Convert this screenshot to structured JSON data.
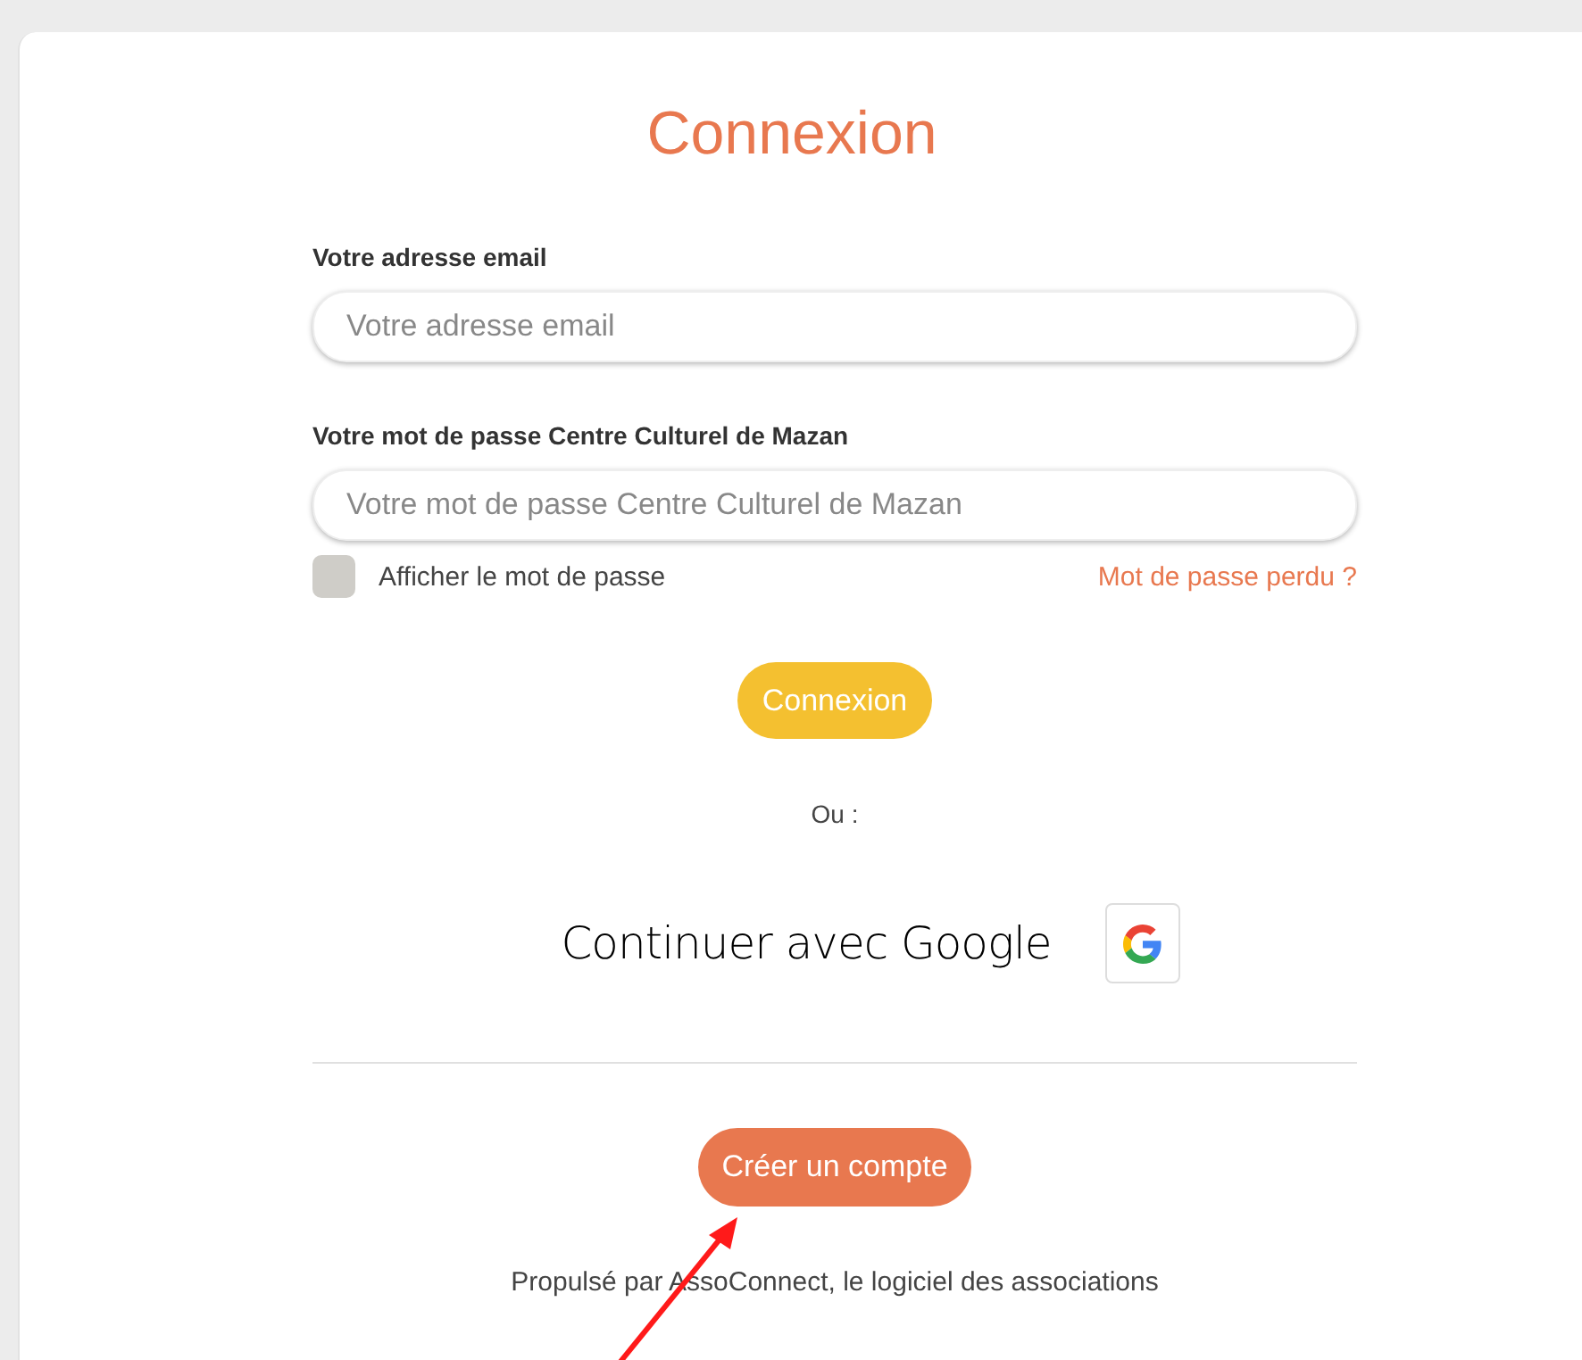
{
  "title": "Connexion",
  "fields": [
    {
      "label": "Votre adresse email",
      "placeholder": "Votre adresse email"
    },
    {
      "label": "Votre mot de passe Centre Culturel de Mazan",
      "placeholder": "Votre mot de passe Centre Culturel de Mazan"
    }
  ],
  "show_password": {
    "label": "Afficher le mot de passe",
    "checked": false
  },
  "forgot_link": "Mot de passe perdu ?",
  "login_button": "Connexion",
  "separator": "Ou :",
  "google": {
    "label": "Continuer avec Google"
  },
  "create_button": "Créer un compte",
  "footer": "Propulsé par AssoConnect, le logiciel des associations"
}
